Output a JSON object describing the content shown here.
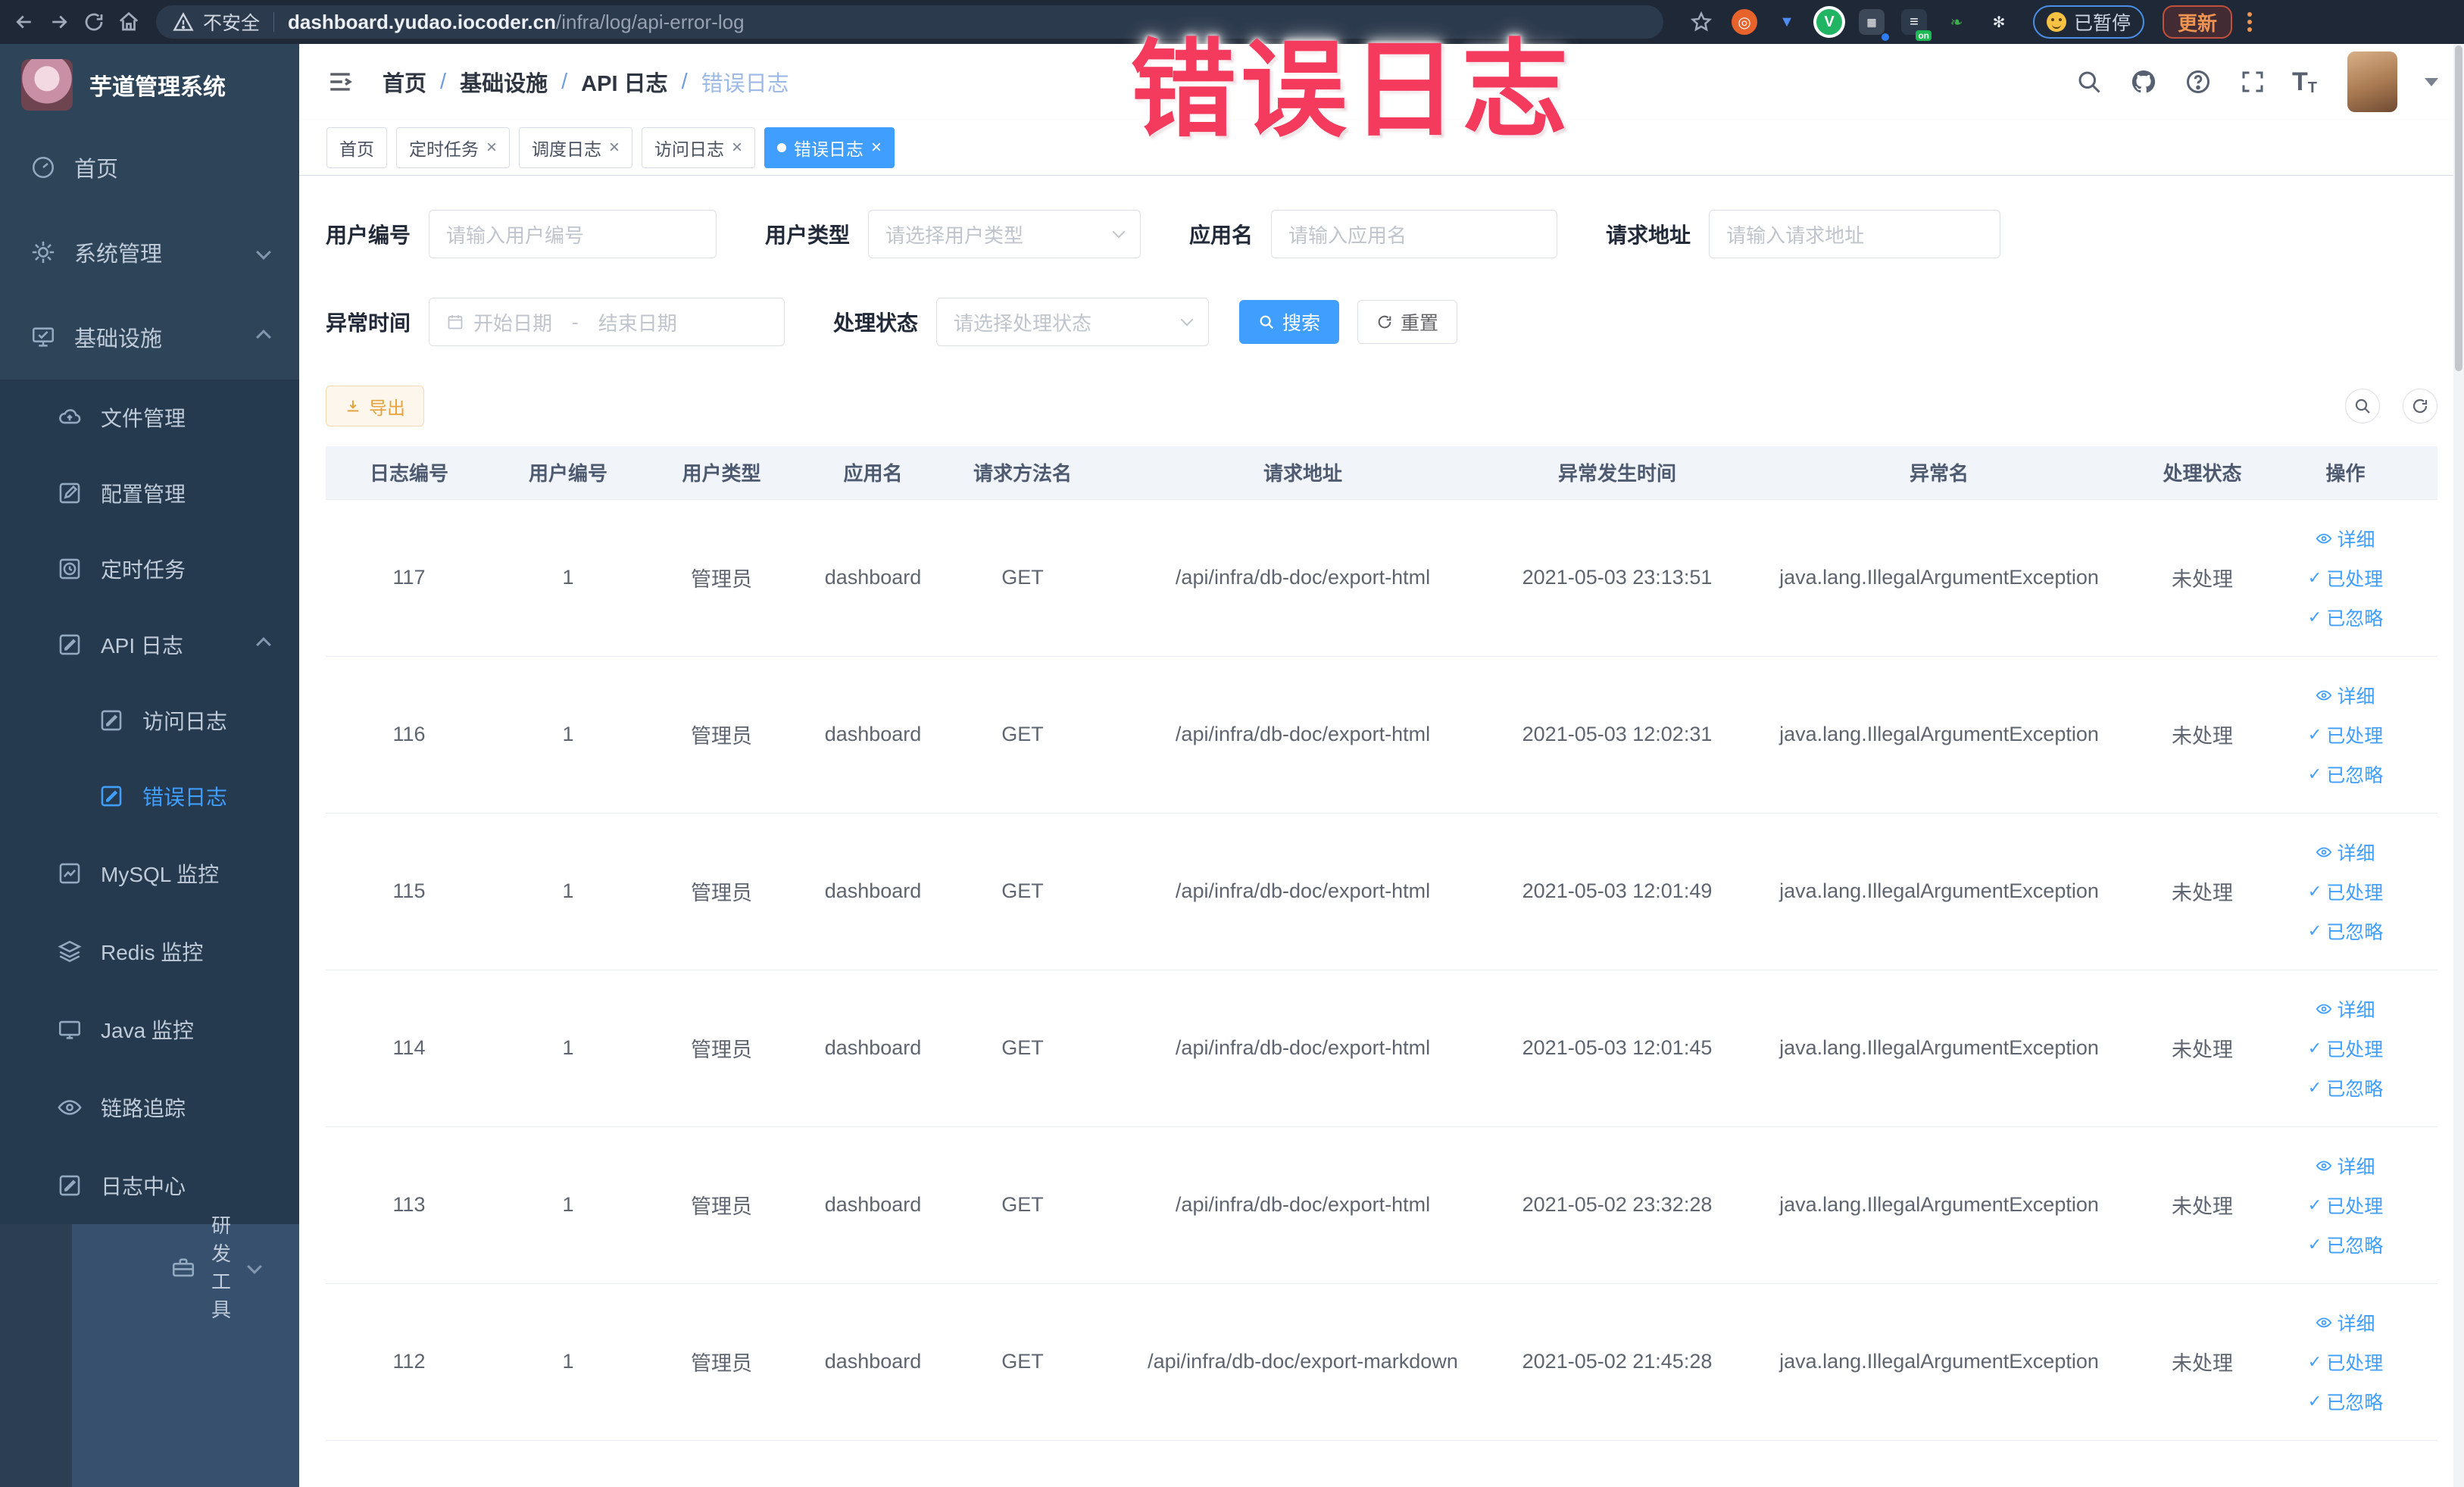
{
  "browser": {
    "security_label": "不安全",
    "url_domain": "dashboard.yudao.iocoder.cn",
    "url_path": "/infra/log/api-error-log",
    "paused_badge": "已暂停",
    "update_button": "更新"
  },
  "annotation": {
    "text": "错误日志",
    "color": "#f43b5e"
  },
  "sidebar": {
    "title": "芋道管理系统",
    "items": [
      {
        "label": "首页"
      },
      {
        "label": "系统管理"
      },
      {
        "label": "基础设施"
      },
      {
        "label": "文件管理"
      },
      {
        "label": "配置管理"
      },
      {
        "label": "定时任务"
      },
      {
        "label": "API 日志"
      },
      {
        "label": "访问日志"
      },
      {
        "label": "错误日志"
      },
      {
        "label": "MySQL 监控"
      },
      {
        "label": "Redis 监控"
      },
      {
        "label": "Java 监控"
      },
      {
        "label": "链路追踪"
      },
      {
        "label": "日志中心"
      },
      {
        "label": "研发工具"
      }
    ]
  },
  "breadcrumb": {
    "items": [
      "首页",
      "基础设施",
      "API 日志",
      "错误日志"
    ],
    "separator": "/"
  },
  "tags": [
    {
      "label": "首页"
    },
    {
      "label": "定时任务"
    },
    {
      "label": "调度日志"
    },
    {
      "label": "访问日志"
    },
    {
      "label": "错误日志"
    }
  ],
  "filters": {
    "user_id_label": "用户编号",
    "user_id_placeholder": "请输入用户编号",
    "user_type_label": "用户类型",
    "user_type_placeholder": "请选择用户类型",
    "app_name_label": "应用名",
    "app_name_placeholder": "请输入应用名",
    "request_url_label": "请求地址",
    "request_url_placeholder": "请输入请求地址",
    "exception_time_label": "异常时间",
    "date_start_placeholder": "开始日期",
    "date_separator": "-",
    "date_end_placeholder": "结束日期",
    "process_status_label": "处理状态",
    "process_status_placeholder": "请选择处理状态",
    "search_button": "搜索",
    "reset_button": "重置"
  },
  "toolbar": {
    "export_button": "导出"
  },
  "table": {
    "headers": [
      "日志编号",
      "用户编号",
      "用户类型",
      "应用名",
      "请求方法名",
      "请求地址",
      "异常发生时间",
      "异常名",
      "处理状态",
      "操作"
    ],
    "actions": [
      "详细",
      "已处理",
      "已忽略"
    ],
    "rows": [
      {
        "id": "117",
        "user_id": "1",
        "user_type": "管理员",
        "app": "dashboard",
        "method": "GET",
        "url": "/api/infra/db-doc/export-html",
        "time": "2021-05-03 23:13:51",
        "exception": "java.lang.IllegalArgumentException",
        "status": "未处理"
      },
      {
        "id": "116",
        "user_id": "1",
        "user_type": "管理员",
        "app": "dashboard",
        "method": "GET",
        "url": "/api/infra/db-doc/export-html",
        "time": "2021-05-03 12:02:31",
        "exception": "java.lang.IllegalArgumentException",
        "status": "未处理"
      },
      {
        "id": "115",
        "user_id": "1",
        "user_type": "管理员",
        "app": "dashboard",
        "method": "GET",
        "url": "/api/infra/db-doc/export-html",
        "time": "2021-05-03 12:01:49",
        "exception": "java.lang.IllegalArgumentException",
        "status": "未处理"
      },
      {
        "id": "114",
        "user_id": "1",
        "user_type": "管理员",
        "app": "dashboard",
        "method": "GET",
        "url": "/api/infra/db-doc/export-html",
        "time": "2021-05-03 12:01:45",
        "exception": "java.lang.IllegalArgumentException",
        "status": "未处理"
      },
      {
        "id": "113",
        "user_id": "1",
        "user_type": "管理员",
        "app": "dashboard",
        "method": "GET",
        "url": "/api/infra/db-doc/export-html",
        "time": "2021-05-02 23:32:28",
        "exception": "java.lang.IllegalArgumentException",
        "status": "未处理"
      },
      {
        "id": "112",
        "user_id": "1",
        "user_type": "管理员",
        "app": "dashboard",
        "method": "GET",
        "url": "/api/infra/db-doc/export-markdown",
        "time": "2021-05-02 21:45:28",
        "exception": "java.lang.IllegalArgumentException",
        "status": "未处理"
      }
    ]
  },
  "colors": {
    "accent": "#409eff",
    "warning": "#e6a23c",
    "annotation_pink": "#f43b5e",
    "sidebar_bg": "#2e4459"
  }
}
